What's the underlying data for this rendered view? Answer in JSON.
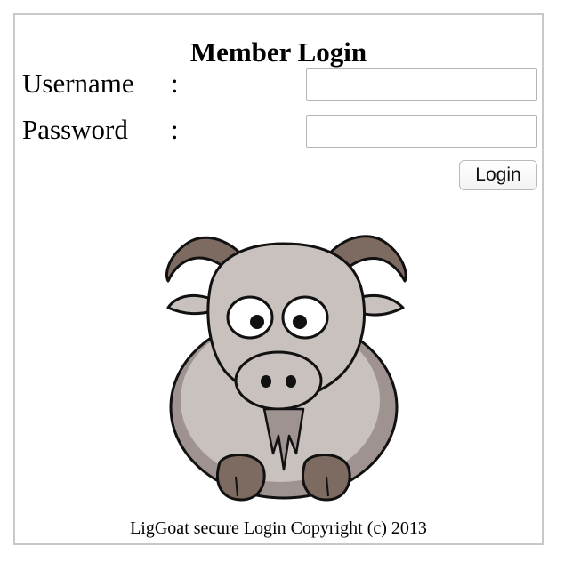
{
  "form": {
    "title": "Member Login",
    "username_label": "Username",
    "password_label": "Password",
    "separator": ":",
    "username_value": "",
    "password_value": "",
    "login_button_label": "Login"
  },
  "footer": {
    "text": "LigGoat secure Login Copyright (c) 2013"
  },
  "colors": {
    "border": "#c8c8c8",
    "goat_body": "#c9c1bd",
    "goat_horns": "#7d6a60",
    "goat_shadow": "#9e9390"
  }
}
